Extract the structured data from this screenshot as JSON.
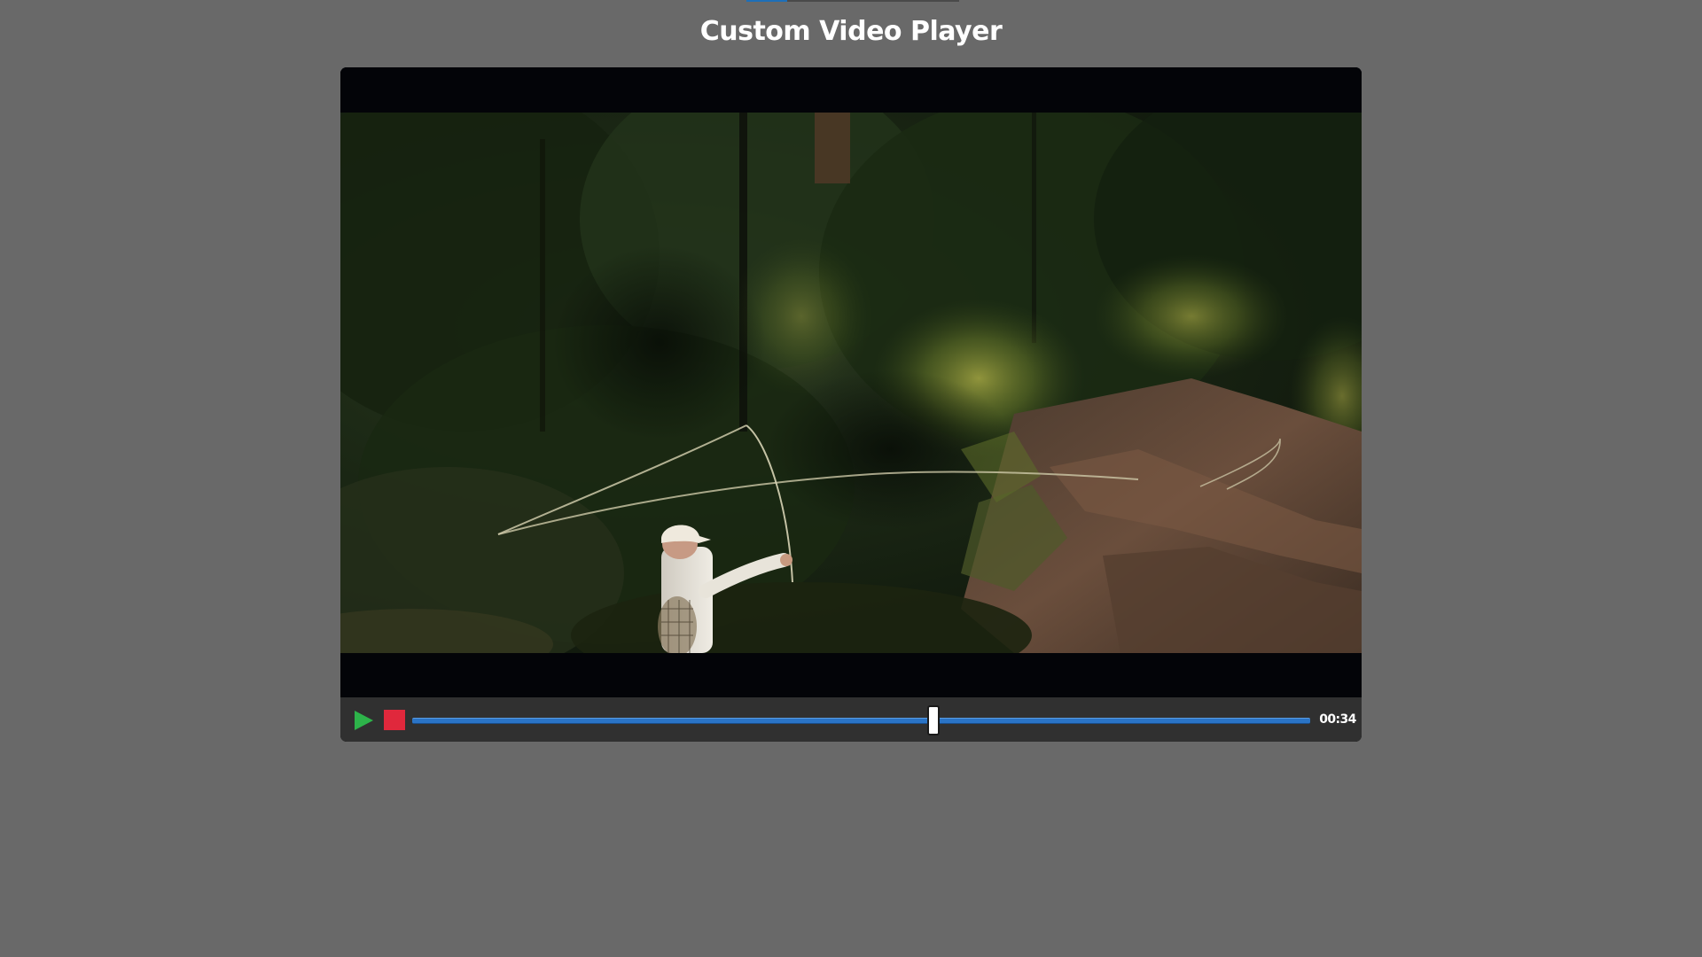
{
  "page": {
    "title": "Custom Video Player"
  },
  "player": {
    "time": "00:34",
    "progress": 0.58,
    "loading_progress": 0.19,
    "play_icon": "play-icon",
    "stop_icon": "stop-icon",
    "colors": {
      "play": "#2db34a",
      "stop": "#e0283c",
      "track": "#2a74c6",
      "background": "#696969"
    }
  }
}
